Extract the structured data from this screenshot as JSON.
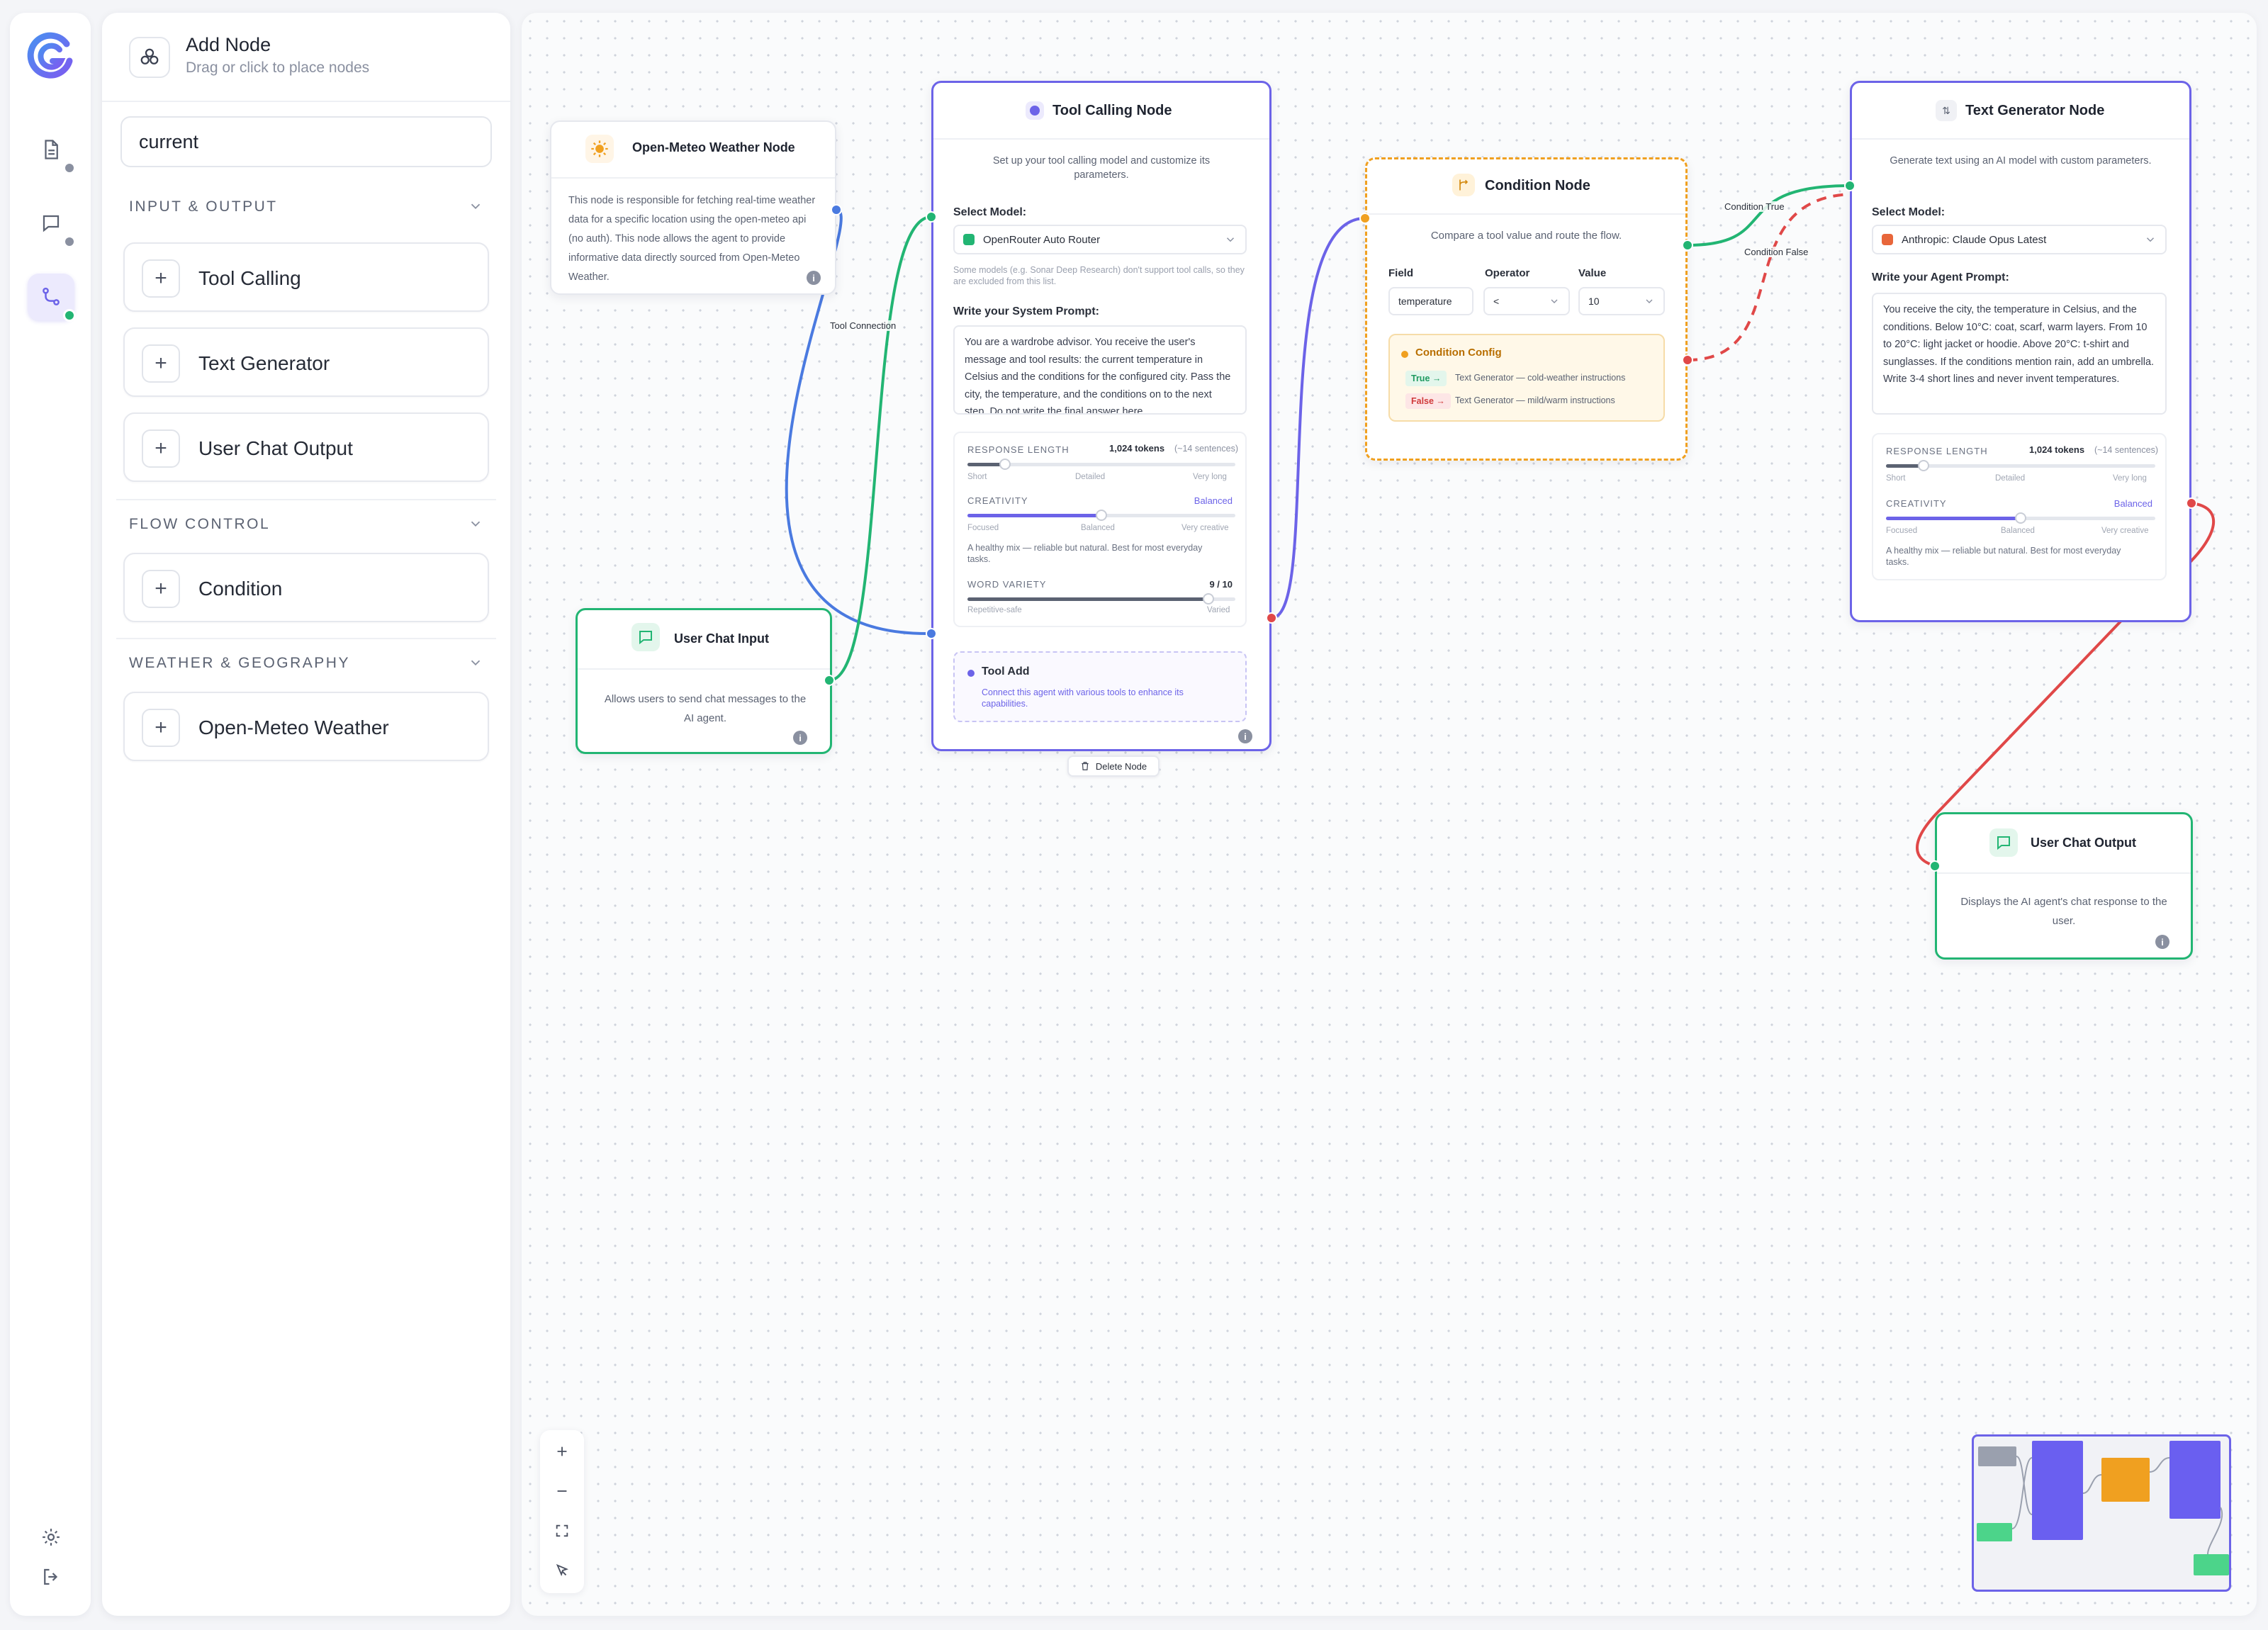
{
  "rail": {
    "items": [
      {
        "name": "document-icon",
        "dot": "#8a90a0"
      },
      {
        "name": "chat-icon",
        "dot": "#8a90a0"
      },
      {
        "name": "workflow-icon",
        "dot": "#22b573"
      }
    ]
  },
  "panel": {
    "title": "Add Node",
    "subtitle": "Drag or click to place nodes",
    "search_value": "current",
    "sections": [
      {
        "title": "INPUT & OUTPUT",
        "items": [
          "Tool Calling",
          "Text Generator",
          "User Chat Output"
        ]
      },
      {
        "title": "FLOW CONTROL",
        "items": [
          "Condition"
        ]
      },
      {
        "title": "WEATHER & GEOGRAPHY",
        "items": [
          "Open-Meteo Weather"
        ]
      }
    ]
  },
  "colors": {
    "accent": "#6c63e8",
    "green": "#22b573",
    "orange": "#f0a020",
    "red": "#e04848",
    "blue": "#4a7ae0"
  },
  "nodes": {
    "weather": {
      "title": "Open-Meteo Weather Node",
      "description": "This node is responsible for fetching real-time weather data for a specific location using the open-meteo api (no auth). This node allows the agent to provide informative data directly sourced from Open-Meteo Weather."
    },
    "chat_input": {
      "title": "User Chat Input",
      "description": "Allows users to send chat messages to the AI agent."
    },
    "tool_calling": {
      "title": "Tool Calling Node",
      "subtitle": "Set up your tool calling model and customize its parameters.",
      "model_label": "Select Model:",
      "model_value": "OpenRouter Auto Router",
      "model_note": "Some models (e.g. Sonar Deep Research) don't support tool calls, so they are excluded from this list.",
      "prompt_label": "Write your System Prompt:",
      "prompt": "You are a wardrobe advisor. You receive the user's message and tool results: the current temperature in Celsius and the conditions for the configured city. Pass the city, the temperature, and the conditions on to the next step. Do not write the final answer here.",
      "response_length": {
        "label": "RESPONSE LENGTH",
        "value": "1,024 tokens",
        "hint": "(~14 sentences)",
        "ticks": [
          "Short",
          "Detailed",
          "Very long"
        ],
        "level": 0.14
      },
      "creativity": {
        "label": "CREATIVITY",
        "value": "Balanced",
        "ticks": [
          "Focused",
          "Balanced",
          "Very creative"
        ],
        "level": 0.5,
        "note": "A healthy mix — reliable but natural. Best for most everyday tasks."
      },
      "word_variety": {
        "label": "WORD VARIETY",
        "value": "9 / 10",
        "ticks": [
          "Repetitive-safe",
          "Varied"
        ],
        "level": 0.9
      },
      "tool_add": {
        "title": "Tool Add",
        "description": "Connect this agent with various tools to enhance its capabilities."
      },
      "delete_label": "Delete Node"
    },
    "condition": {
      "title": "Condition Node",
      "subtitle": "Compare a tool value and route the flow.",
      "field_label": "Field",
      "operator_label": "Operator",
      "value_label": "Value",
      "field_value": "temperature",
      "operator_value": "<",
      "value_value": "10",
      "config_title": "Condition Config",
      "true_tag": "True →",
      "true_text": "Text Generator — cold-weather instructions",
      "false_tag": "False →",
      "false_text": "Text Generator — mild/warm instructions"
    },
    "text_gen": {
      "title": "Text Generator Node",
      "subtitle": "Generate text using an AI model with custom parameters.",
      "model_label": "Select Model:",
      "model_value": "Anthropic: Claude Opus Latest",
      "prompt_label": "Write your Agent Prompt:",
      "prompt": "You receive the city, the temperature in Celsius, and the conditions. Below 10°C: coat, scarf, warm layers. From 10 to 20°C: light jacket or hoodie. Above 20°C: t-shirt and sunglasses. If the conditions mention rain, add an umbrella. Write 3-4 short lines and never invent temperatures.",
      "response_length": {
        "label": "RESPONSE LENGTH",
        "value": "1,024 tokens",
        "hint": "(~14 sentences)",
        "ticks": [
          "Short",
          "Detailed",
          "Very long"
        ],
        "level": 0.14
      },
      "creativity": {
        "label": "CREATIVITY",
        "value": "Balanced",
        "ticks": [
          "Focused",
          "Balanced",
          "Very creative"
        ],
        "level": 0.5,
        "note": "A healthy mix — reliable but natural. Best for most everyday tasks."
      }
    },
    "chat_output": {
      "title": "User Chat Output",
      "description": "Displays the AI agent's chat response to the user."
    }
  },
  "edges": {
    "tool_connection": "Tool Connection",
    "condition_true": "Condition True",
    "condition_false": "Condition False"
  }
}
